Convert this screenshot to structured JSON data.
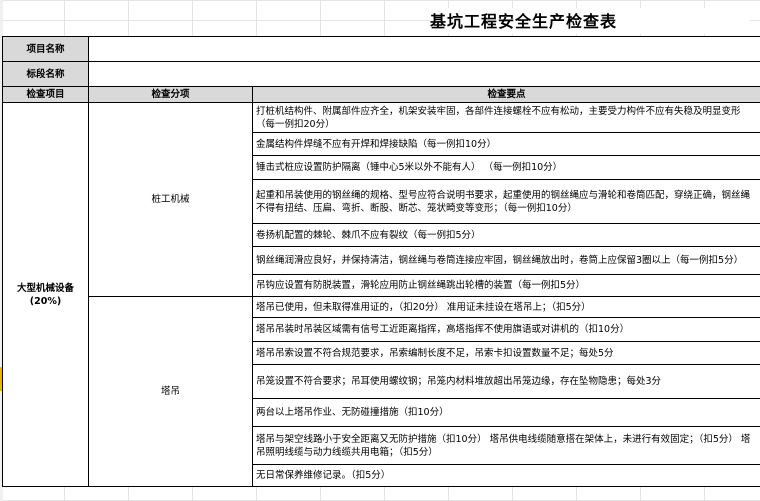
{
  "title": "基坑工程安全生产检查表",
  "project_label": "项目名称",
  "project_value": "",
  "section_label": "标段名称",
  "section_value": "",
  "headers": {
    "col1": "检查项目",
    "col2": "检查分项",
    "col3": "检查要点"
  },
  "category": {
    "name": "大型机械设备",
    "weight": "(20%)"
  },
  "groups": [
    {
      "name": "桩工机械",
      "items": [
        "打桩机结构件、附属部件应齐全，机架安装牢固，各部件连接螺栓不应有松动，主要受力构件不应有失稳及明显变形（每一例扣20分）",
        "金属结构件焊缝不应有开焊和焊接缺陷（每一例扣10分）",
        "锤击式桩应设置防护隔离（锤中心5米以外不能有人）  （每一例扣10分）",
        "起重和吊装使用的钢丝绳的规格、型号应符合说明书要求，起重使用的钢丝绳应与滑轮和卷筒匹配，穿绕正确，钢丝绳不得有扭结、压扁、弯折、断股、断芯、笼状畸变等变形；（每一例扣10分）",
        "卷扬机配置的棘轮、棘爪不应有裂纹（每一例扣5分）",
        "钢丝绳润滑应良好，并保持清洁，钢丝绳与卷筒连接应牢固，钢丝绳放出时，卷筒上应保留3圈以上（每一例扣5分）",
        "吊钩应设置有防脱装置，滑轮应用防止钢丝绳跳出轮槽的装置（每一例扣5分）"
      ]
    },
    {
      "name": "塔吊",
      "items": [
        "塔吊已使用，但未取得准用证的，（扣20分）   准用证未挂设在塔吊上；（扣5分）",
        "塔吊吊装时吊装区域需有信号工近距离指挥，高塔指挥不使用旗语或对讲机的（扣10分）",
        "塔吊吊索设置不符合规范要求，吊索编制长度不足，吊索卡扣设置数量不足；每处5分",
        "吊笼设置不符合要求；吊耳使用螺纹钢；吊笼内材料堆放超出吊笼边缘，存在坠物隐患；每处3分",
        "两台以上塔吊作业、无防碰撞措施（扣10分）",
        "塔吊与架空线路小于安全距离又无防护措施（扣10分） 塔吊供电线缆随意搭在架体上，未进行有效固定；（扣5分） 塔吊照明线缆与动力线缆共用电箱；（扣5分）",
        "无日常保养维修记录。（扣5分）"
      ]
    }
  ]
}
